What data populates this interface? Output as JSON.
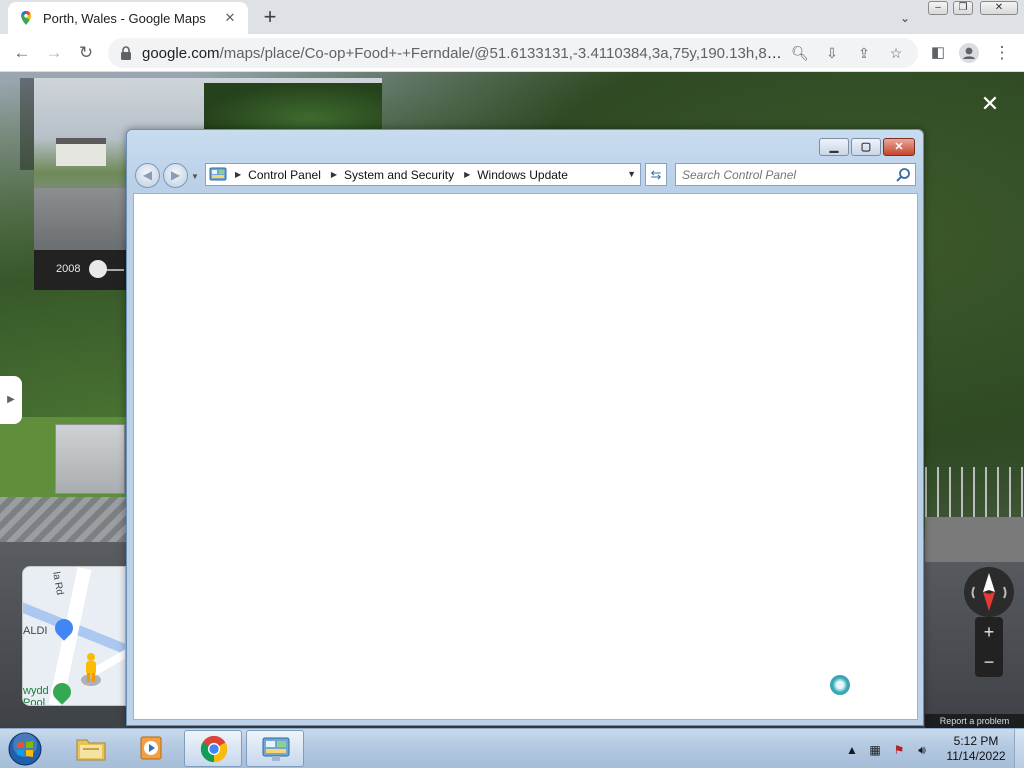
{
  "browser": {
    "tab": {
      "title": "Porth, Wales - Google Maps"
    },
    "url": {
      "host": "google.com",
      "path": "/maps/place/Co-op+Food+-+Ferndale/@51.6133131,-3.4110384,3a,75y,190.13h,87.33t/d..."
    },
    "icons": {
      "back": "back-arrow-icon",
      "forward": "forward-arrow-icon",
      "reload": "reload-icon",
      "lock": "lock-icon",
      "zoom": "search-icon",
      "install": "install-icon",
      "share": "share-icon",
      "bookmark": "star-icon",
      "sidepanel": "side-panel-icon",
      "profile": "profile-icon",
      "menu": "more-vert-icon"
    }
  },
  "streetview": {
    "year_label": "2008",
    "report_label": "Report a problem",
    "minimap": {
      "road_label": "la Rd",
      "store1": "ALDI",
      "store2_line1": "wydd",
      "store2_line2": "Pool"
    },
    "zoom_in": "+",
    "zoom_out": "−"
  },
  "control_panel": {
    "breadcrumbs": [
      "Control Panel",
      "System and Security",
      "Windows Update"
    ],
    "search_placeholder": "Search Control Panel"
  },
  "taskbar": {
    "apps": [
      "Windows Explorer",
      "Windows Media Player",
      "Google Chrome",
      "Control Panel"
    ],
    "clock_time": "5:12 PM",
    "clock_date": "11/14/2022"
  },
  "colors": {
    "aero_accent": "#6d8fb3",
    "close_red": "#c6452d",
    "taskbar": "#b3c9e1",
    "busy_teal": "#3aa6b3"
  }
}
